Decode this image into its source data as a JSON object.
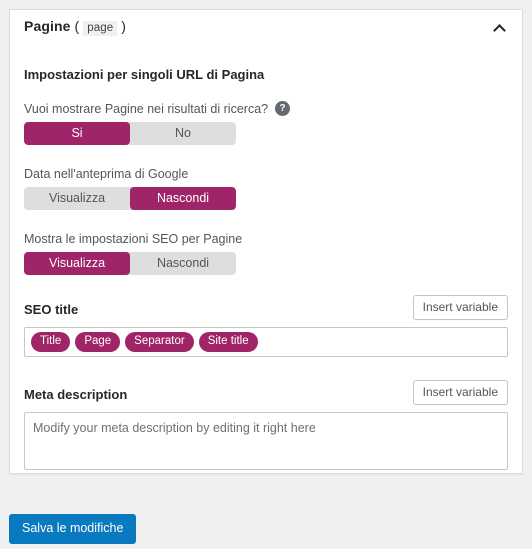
{
  "page": {
    "background_color": "#f0f0f1",
    "accent_color": "#a02568",
    "primary_button_color": "#0a7ac0"
  },
  "panel": {
    "title": "Pagine",
    "paren_open": "(",
    "post_type_slug": "page",
    "paren_close": ")",
    "collapse_icon": "chevron-up-icon",
    "section_heading": "Impostazioni per singoli URL di Pagina"
  },
  "settings": [
    {
      "label": "Vuoi mostrare Pagine nei risultati di ricerca?",
      "help_icon": "help-circle-icon",
      "help_glyph": "?",
      "has_help": true,
      "options": [
        "Si",
        "No"
      ],
      "selected_index": 0
    },
    {
      "label": "Data nell'anteprima di Google",
      "has_help": false,
      "options": [
        "Visualizza",
        "Nascondi"
      ],
      "selected_index": 1
    },
    {
      "label": "Mostra le impostazioni SEO per Pagine",
      "has_help": false,
      "options": [
        "Visualizza",
        "Nascondi"
      ],
      "selected_index": 0
    }
  ],
  "seo_title": {
    "label": "SEO title",
    "insert_variable_label": "Insert variable",
    "chips": [
      "Title",
      "Page",
      "Separator",
      "Site title"
    ]
  },
  "meta_description": {
    "label": "Meta description",
    "insert_variable_label": "Insert variable",
    "placeholder": "Modify your meta description by editing it right here",
    "value": ""
  },
  "footer": {
    "save_label": "Salva le modifiche"
  }
}
